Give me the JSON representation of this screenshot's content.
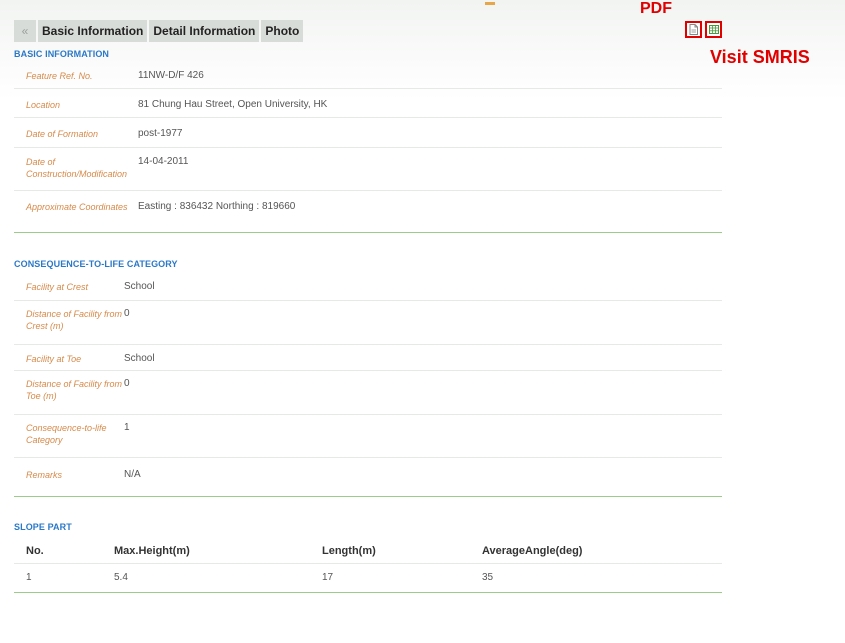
{
  "tabs": [
    {
      "label": "Basic Information"
    },
    {
      "label": "Detail Information"
    },
    {
      "label": "Photo"
    }
  ],
  "annotations": {
    "pdf": "PDF",
    "visit_smris": "Visit SMRIS"
  },
  "basic_information": {
    "title": "BASIC INFORMATION",
    "rows": [
      {
        "label": "Feature Ref. No.",
        "value": "11NW-D/F 426"
      },
      {
        "label": "Location",
        "value": "81 Chung Hau Street, Open University, HK"
      },
      {
        "label": "Date of Formation",
        "value": "post-1977"
      },
      {
        "label": "Date of Construction/Modification",
        "value": "14-04-2011"
      },
      {
        "label": "Approximate Coordinates",
        "value": "Easting : 836432 Northing : 819660"
      }
    ]
  },
  "consequence": {
    "title": "CONSEQUENCE-TO-LIFE CATEGORY",
    "rows": [
      {
        "label": "Facility at Crest",
        "value": "School"
      },
      {
        "label": "Distance of Facility from Crest (m)",
        "value": "0"
      },
      {
        "label": "Facility at Toe",
        "value": "School"
      },
      {
        "label": "Distance of Facility from Toe (m)",
        "value": "0"
      },
      {
        "label": "Consequence-to-life Category",
        "value": "1"
      },
      {
        "label": "Remarks",
        "value": "N/A"
      }
    ]
  },
  "slope_part": {
    "title": "SLOPE PART",
    "columns": [
      "No.",
      "Max.Height(m)",
      "Length(m)",
      "AverageAngle(deg)"
    ],
    "rows": [
      [
        "1",
        "5.4",
        "17",
        "35"
      ]
    ]
  },
  "colors": {
    "accent_blue": "#2a78c8",
    "label_orange": "#d68a4a",
    "annotation_red": "#e00000",
    "divider_green": "#9ccc8c"
  }
}
